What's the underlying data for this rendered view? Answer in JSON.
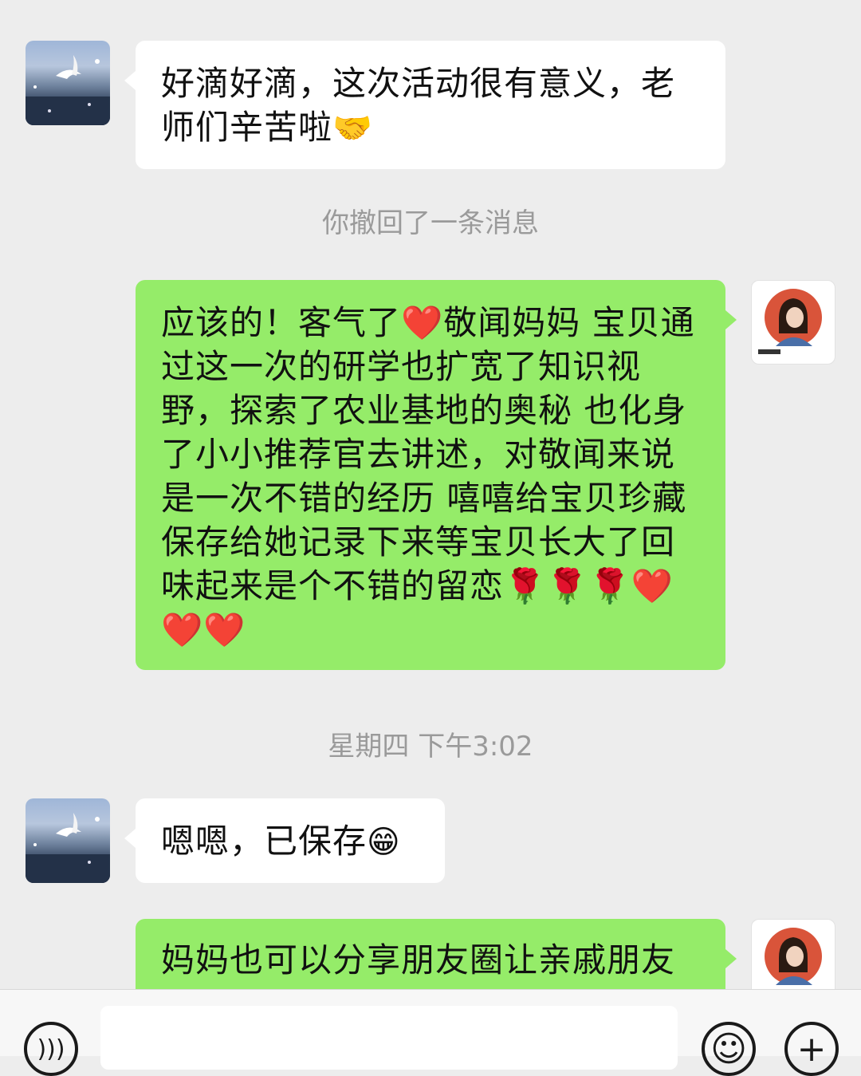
{
  "messages": [
    {
      "text": "好滴好滴，这次活动很有意义，老师们辛苦啦",
      "emoji": "🤝"
    },
    {
      "system": "你撤回了一条消息"
    },
    {
      "text": "应该的！客气了❤️敬闻妈妈 宝贝通过这一次的研学也扩宽了知识视野，探索了农业基地的奥秘 也化身了小小推荐官去讲述，对敬闻来说是一次不错的经历 嘻嘻给宝贝珍藏保存给她记录下来等宝贝长大了回味起来是个不错的留恋🌹🌹🌹❤️❤️❤️"
    },
    {
      "timestamp": "星期四 下午3:02"
    },
    {
      "text": "嗯嗯，已保存",
      "emoji": "😁"
    },
    {
      "text": "妈妈也可以分享朋友圈让亲戚朋友"
    }
  ],
  "colors": {
    "outgoing": "#95ec69",
    "incoming": "#ffffff",
    "background": "#ededed"
  },
  "icons": {
    "voice": "voice-icon",
    "emoji": "emoji-icon",
    "plus": "plus-icon"
  }
}
